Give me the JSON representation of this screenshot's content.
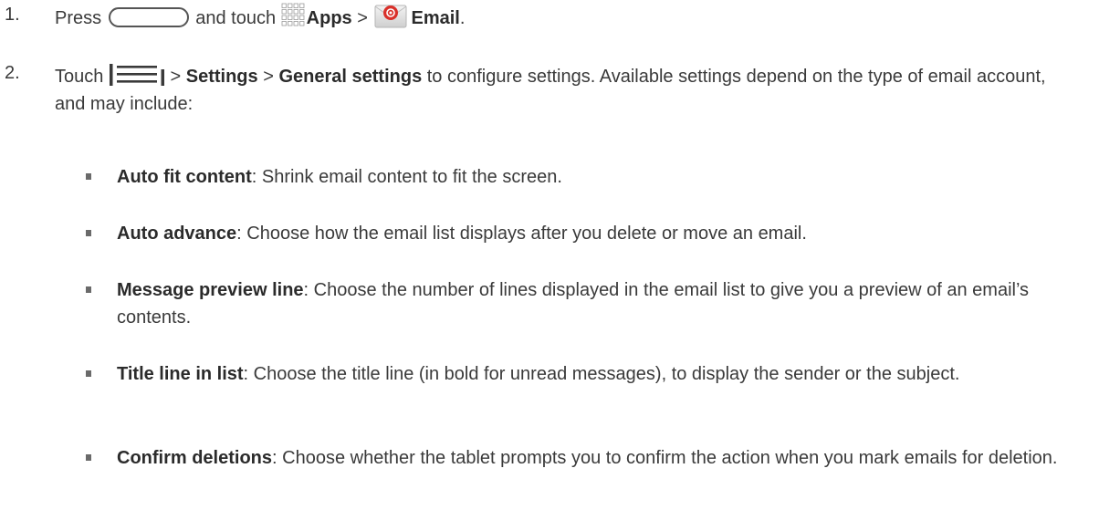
{
  "step1": {
    "number": "1.",
    "press": "Press",
    "and_touch": "and touch",
    "apps_label": "Apps",
    "sep": ">",
    "email_label": "Email",
    "end": ".",
    "icons": [
      "home-key",
      "apps-icon",
      "email-icon"
    ]
  },
  "step2": {
    "number": "2.",
    "touch": "Touch",
    "sep1": ">",
    "settings_label": "Settings",
    "sep2": ">",
    "general_settings_label": "General settings",
    "rest": "to configure settings. Available settings depend on the type of email account, and may include:",
    "icons": [
      "menu-key"
    ]
  },
  "settings": [
    {
      "term": "Auto fit content",
      "desc": ": Shrink email content to fit the screen."
    },
    {
      "term": "Auto advance",
      "desc": ": Choose how the email list displays after you delete or move an email."
    },
    {
      "term": "Message preview line",
      "desc": ": Choose the number of lines displayed in the email list to give you a preview of an email’s contents."
    },
    {
      "term": "Title line in list",
      "desc": ": Choose the title line (in bold for unread messages), to display the sender or the subject."
    },
    {
      "term": "Confirm deletions",
      "desc": ": Choose whether the tablet prompts you to confirm the action when you mark emails for deletion."
    }
  ],
  "colors": {
    "text": "#3a3a3a",
    "email_icon_red": "#d9302a",
    "bullet": "#6a6a6a"
  }
}
